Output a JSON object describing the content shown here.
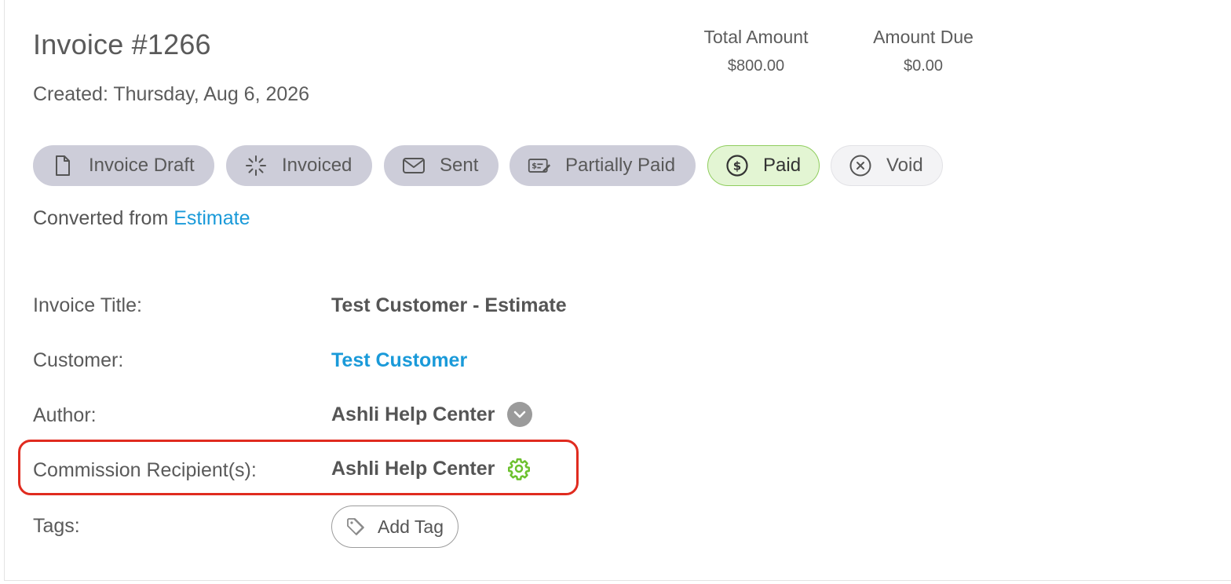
{
  "invoice": {
    "title": "Invoice #1266",
    "created": "Created: Thursday, Aug 6, 2026"
  },
  "amounts": {
    "total_label": "Total Amount",
    "total_value": "$800.00",
    "due_label": "Amount Due",
    "due_value": "$0.00"
  },
  "statuses": [
    {
      "label": "Invoice Draft",
      "icon": "document-icon"
    },
    {
      "label": "Invoiced",
      "icon": "loading-spinner-icon"
    },
    {
      "label": "Sent",
      "icon": "envelope-icon"
    },
    {
      "label": "Partially Paid",
      "icon": "check-payment-icon"
    },
    {
      "label": "Paid",
      "icon": "dollar-circle-icon",
      "active": true
    },
    {
      "label": "Void",
      "icon": "x-circle-icon"
    }
  ],
  "converted": {
    "prefix": "Converted from",
    "link": "Estimate"
  },
  "fields": {
    "title_label": "Invoice Title:",
    "title_value": "Test Customer - Estimate",
    "customer_label": "Customer:",
    "customer_value": "Test Customer",
    "author_label": "Author:",
    "author_value": "Ashli Help Center",
    "commission_label": "Commission Recipient(s):",
    "commission_value": "Ashli Help Center",
    "tags_label": "Tags:",
    "add_tag": "Add Tag"
  },
  "colors": {
    "link": "#1a9ad9",
    "status_pill": "#cdcdd9",
    "paid_bg": "#e3f5d3",
    "paid_border": "#8fcd5d",
    "highlight": "#e02b1f",
    "gear": "#6cc12e"
  }
}
